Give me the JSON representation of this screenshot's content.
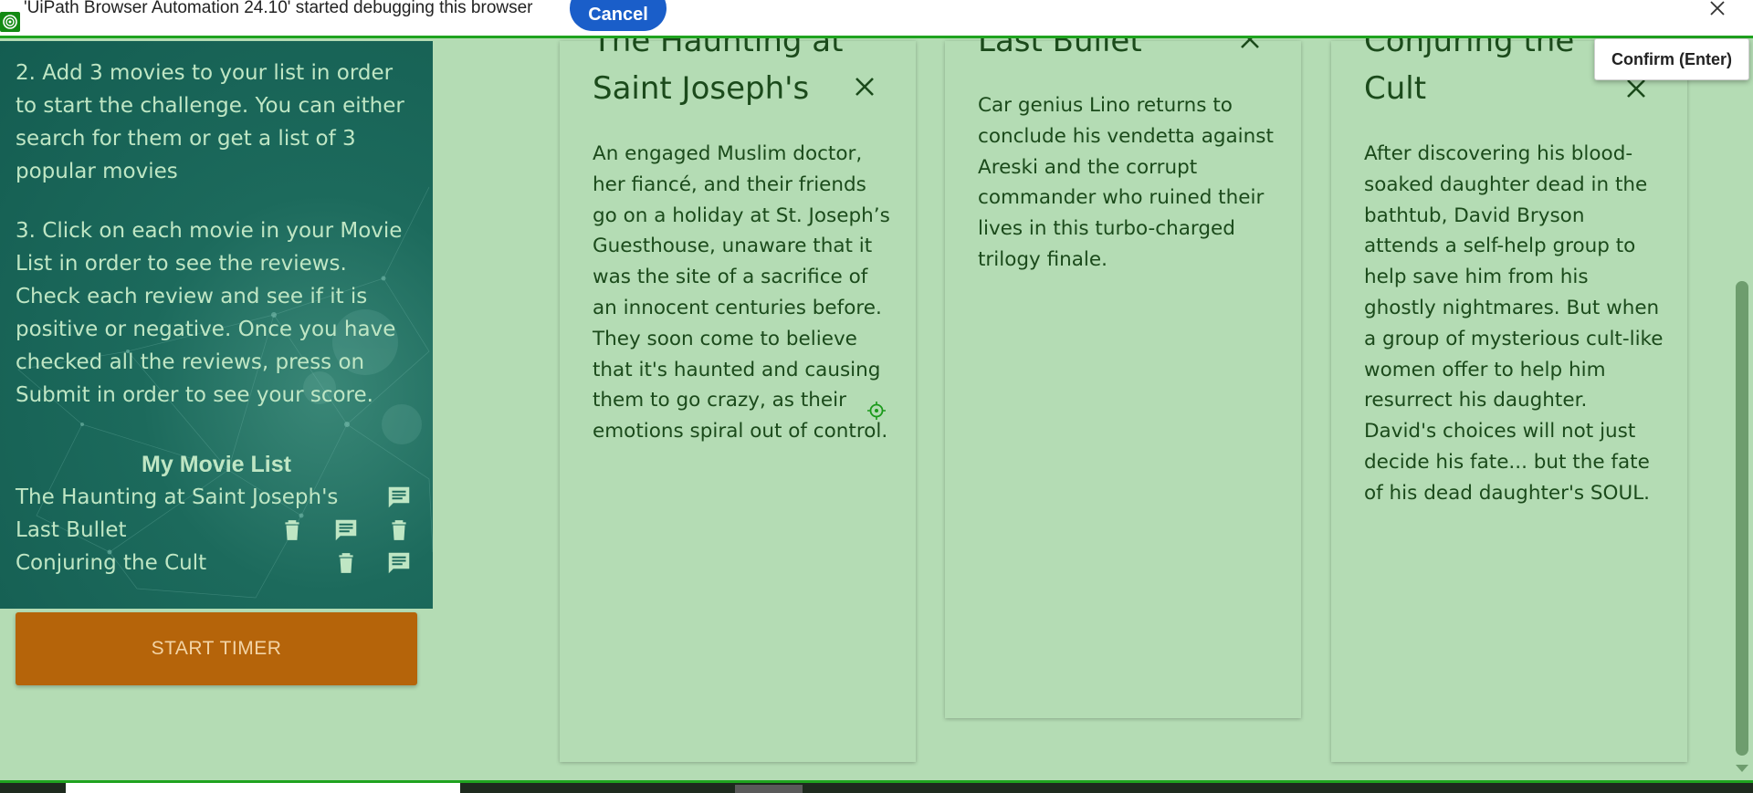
{
  "debug_banner": {
    "message": "'UiPath Browser Automation 24.10' started debugging this browser",
    "cancel_label": "Cancel"
  },
  "instructions": {
    "step2": "2. Add 3 movies to your list in order to start the challenge. You can either search for them or get a list of 3 popular movies",
    "step3": "3. Click on each movie in your Movie List in order to see the reviews. Check each review and see if it is positive or negative. Once you have checked all the reviews, press on Submit in order to see your score."
  },
  "movie_list": {
    "title": "My Movie List",
    "items": [
      {
        "title": "The Haunting at Saint Joseph's",
        "icons": [
          "comment-icon"
        ]
      },
      {
        "title": "Last Bullet",
        "icons": [
          "trash-icon",
          "comment-icon",
          "trash-icon"
        ]
      },
      {
        "title": "Conjuring the Cult",
        "icons": [
          "trash-icon",
          "comment-icon"
        ]
      }
    ]
  },
  "start_timer_label": "START TIMER",
  "confirm_label": "Confirm (Enter)",
  "cards": [
    {
      "title": "The Haunting at Saint Joseph's",
      "description": "An engaged Muslim doctor, her fiancé, and their friends go on a holiday at St. Joseph’s Guesthouse, unaware that it was the site of a sacrifice of an innocent centuries before. They soon come to believe that it's haunted and causing them to go crazy, as their emotions spiral out of control."
    },
    {
      "title": "Last Bullet",
      "description": "Car genius Lino returns to conclude his vendetta against Areski and the corrupt commander who ruined their lives in this turbo-charged trilogy finale."
    },
    {
      "title": "Conjuring the Cult",
      "description": "After discovering his blood-soaked daughter dead in the bathtub, David Bryson attends a self-help group to help save him from his ghostly nightmares. But when a group of mysterious cult-like women offer to help him resurrect his daughter. David's choices will not just decide his fate... but the fate of his dead daughter's SOUL."
    }
  ],
  "colors": {
    "page_bg": "#b4dcb4",
    "panel_bg": "#145d51",
    "panel_text": "#bfe6c4",
    "card_text": "#1b4a1b",
    "timer_button": "#b5640a",
    "cancel_button": "#1a5ec9",
    "debug_border": "#1fa31f"
  }
}
